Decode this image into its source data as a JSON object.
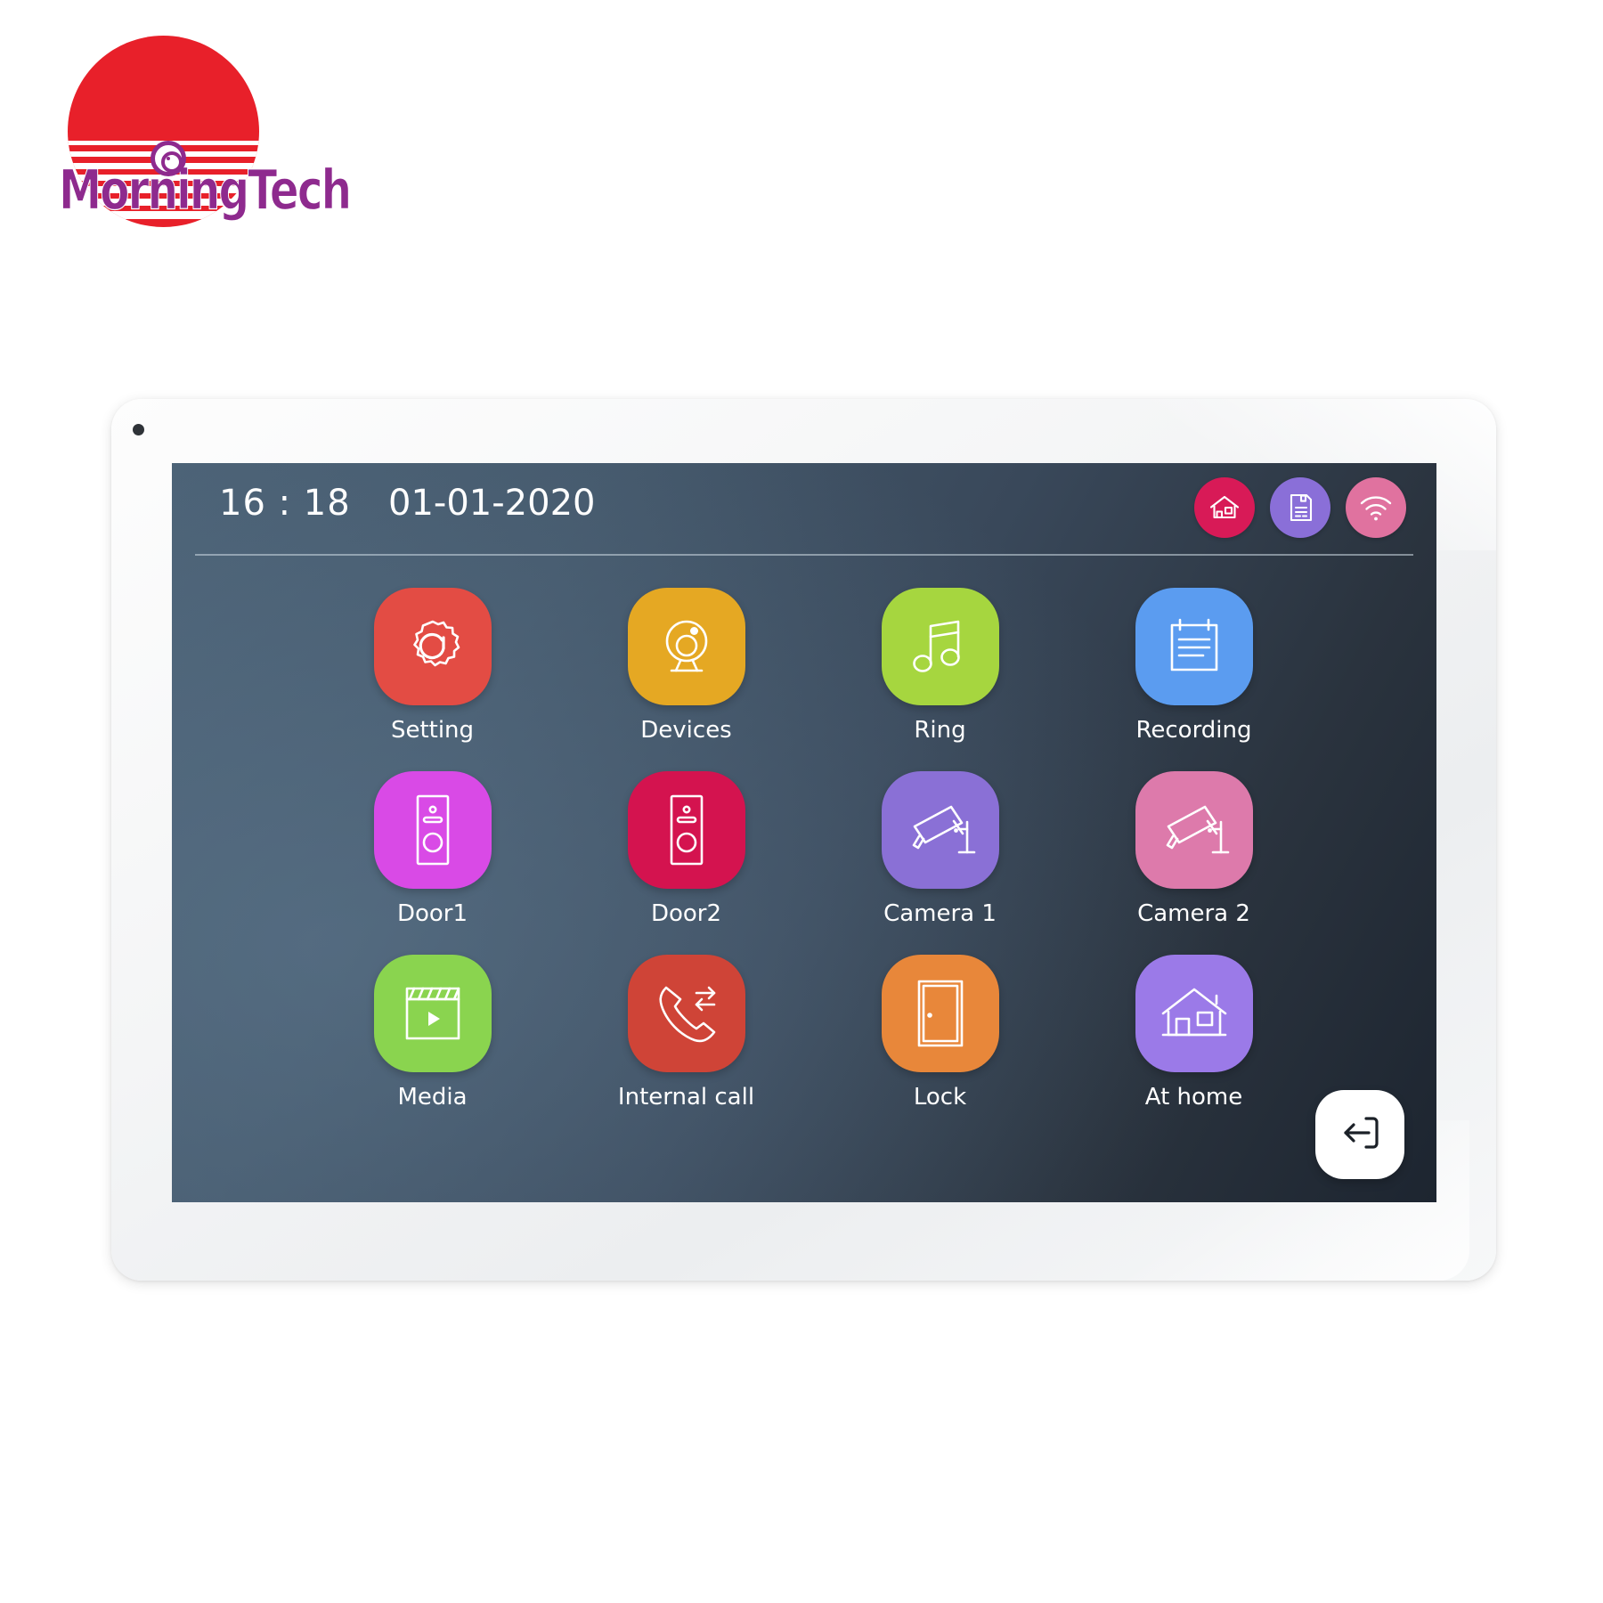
{
  "brand": {
    "logo_name": "logo-morningtech",
    "wordmark": "MorningTech",
    "sun_color": "#e8202a",
    "word_color": "#8e2a8e"
  },
  "device": {
    "name": "video-intercom-monitor",
    "bezel_color": "#f2f3f5",
    "screen_bg_top": "#4a6074",
    "screen_bg_bottom": "#1d2530"
  },
  "status_bar": {
    "time": "16 : 18",
    "date": "01-01-2020",
    "icons": [
      {
        "name": "home-icon",
        "glyph": "house",
        "color": "#d81a57"
      },
      {
        "name": "notes-icon",
        "glyph": "document",
        "color": "#8a6fd8"
      },
      {
        "name": "wifi-icon",
        "glyph": "wifi",
        "color": "#e0729f"
      }
    ]
  },
  "apps": [
    {
      "label": "Setting",
      "icon": "gear-icon",
      "color": "#e34c44"
    },
    {
      "label": "Devices",
      "icon": "webcam-icon",
      "color": "#e5a823"
    },
    {
      "label": "Ring",
      "icon": "music-note-icon",
      "color": "#a6d63f"
    },
    {
      "label": "Recording",
      "icon": "notepad-icon",
      "color": "#5b9cf0"
    },
    {
      "label": "Door1",
      "icon": "door-station-icon",
      "color": "#d94ae6"
    },
    {
      "label": "Door2",
      "icon": "door-station-icon",
      "color": "#d4134f"
    },
    {
      "label": "Camera 1",
      "icon": "cctv-camera-icon",
      "color": "#8a70d6"
    },
    {
      "label": "Camera 2",
      "icon": "cctv-camera-icon",
      "color": "#dd7aab"
    },
    {
      "label": "Media",
      "icon": "clapperboard-icon",
      "color": "#8ad44f"
    },
    {
      "label": "Internal call",
      "icon": "call-transfer-icon",
      "color": "#cf4437"
    },
    {
      "label": "Lock",
      "icon": "door-icon",
      "color": "#e8873a"
    },
    {
      "label": "At home",
      "icon": "house-icon",
      "color": "#9b7ae8"
    }
  ],
  "back_button": {
    "name": "back-exit-button",
    "icon": "exit-arrow-icon",
    "color": "#1b2027"
  }
}
